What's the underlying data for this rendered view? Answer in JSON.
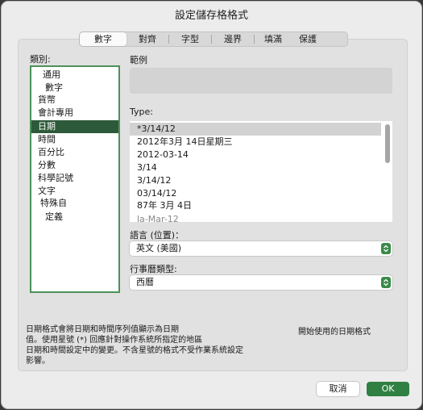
{
  "dialog": {
    "title": "設定儲存格格式"
  },
  "tabs": [
    {
      "label": "數字",
      "active": true
    },
    {
      "label": "對齊",
      "active": false
    },
    {
      "label": "字型",
      "active": false
    },
    {
      "label": "邊界",
      "active": false
    },
    {
      "label": "填滿",
      "active": false
    },
    {
      "label": "保護",
      "active": false
    }
  ],
  "category": {
    "label": "類別:",
    "items": [
      {
        "label": "通用"
      },
      {
        "label": "數字"
      },
      {
        "label": "貨幣"
      },
      {
        "label": "會計專用"
      },
      {
        "label": "日期",
        "selected": true
      },
      {
        "label": "時間"
      },
      {
        "label": "百分比"
      },
      {
        "label": "分數"
      },
      {
        "label": "科學記號"
      },
      {
        "label": "文字"
      },
      {
        "label": "特殊自"
      },
      {
        "label": "定義"
      }
    ]
  },
  "sample": {
    "label": "範例",
    "value": ""
  },
  "type": {
    "label": "Type:",
    "items": [
      {
        "label": "*3/14/12",
        "selected": true
      },
      {
        "label": "2012年3月 14日星期三"
      },
      {
        "label": "2012-03-14"
      },
      {
        "label": "3/14"
      },
      {
        "label": "3/14/12"
      },
      {
        "label": "03/14/12"
      },
      {
        "label": "87年 3月 4日"
      },
      {
        "label": "la-Mar-12"
      }
    ]
  },
  "locale": {
    "label": "語言 (位置)：",
    "value": "英文 (美國)"
  },
  "calendar": {
    "label": "行事曆類型:",
    "value": "西曆"
  },
  "description": {
    "lines": [
      "日期格式會將日期和時間序列值顯示為日期",
      "值。使用星號 (*) 回應針對操作系統所指定的地區",
      "日期和時間設定中的變更。不含星號的格式不受作業系統設定",
      "影響。"
    ],
    "side_note": "開始使用的日期格式"
  },
  "buttons": {
    "cancel": "取消",
    "ok": "OK"
  },
  "colors": {
    "accent": "#2f8042",
    "selected_row": "#2d5a3a"
  }
}
